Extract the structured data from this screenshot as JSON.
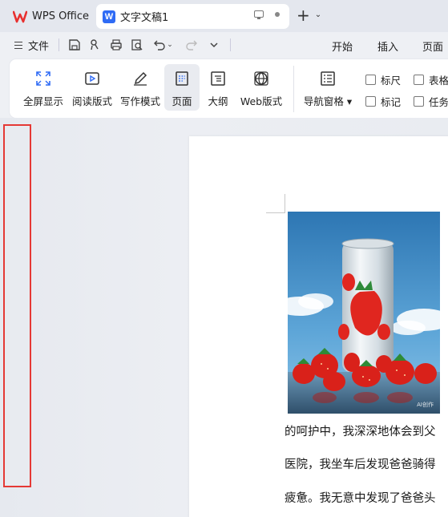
{
  "tabs": {
    "app_label": "WPS Office",
    "doc_label": "文字文稿1",
    "doc_icon_letter": "W"
  },
  "quickbar": {
    "menu_label": "文件",
    "ribbon_tabs": [
      "开始",
      "插入",
      "页面"
    ]
  },
  "ribbon": {
    "buttons": [
      {
        "label": "全屏显示",
        "icon": "fullscreen-icon"
      },
      {
        "label": "阅读版式",
        "icon": "read-mode-icon"
      },
      {
        "label": "写作模式",
        "icon": "write-mode-icon"
      },
      {
        "label": "页面",
        "icon": "page-view-icon",
        "active": true
      },
      {
        "label": "大纲",
        "icon": "outline-icon"
      },
      {
        "label": "Web版式",
        "icon": "web-layout-icon"
      },
      {
        "label": "导航窗格",
        "icon": "nav-pane-icon"
      }
    ],
    "checkboxes": [
      {
        "label": "标尺",
        "checked": false
      },
      {
        "label": "标记",
        "checked": false
      },
      {
        "label": "表格",
        "checked": false
      },
      {
        "label": "任务",
        "checked": false
      }
    ]
  },
  "document": {
    "image_alt": "can-with-strawberries",
    "image_watermark": "AI创作",
    "paragraphs": [
      "的呵护中，我深深地体会到父",
      "医院，我坐车后发现爸爸骑得",
      "疲惫。我无意中发现了爸爸头"
    ]
  },
  "colors": {
    "highlight_border": "#e53935",
    "doc_icon": "#2f6bf5",
    "wps_logo": "#e8302f"
  }
}
